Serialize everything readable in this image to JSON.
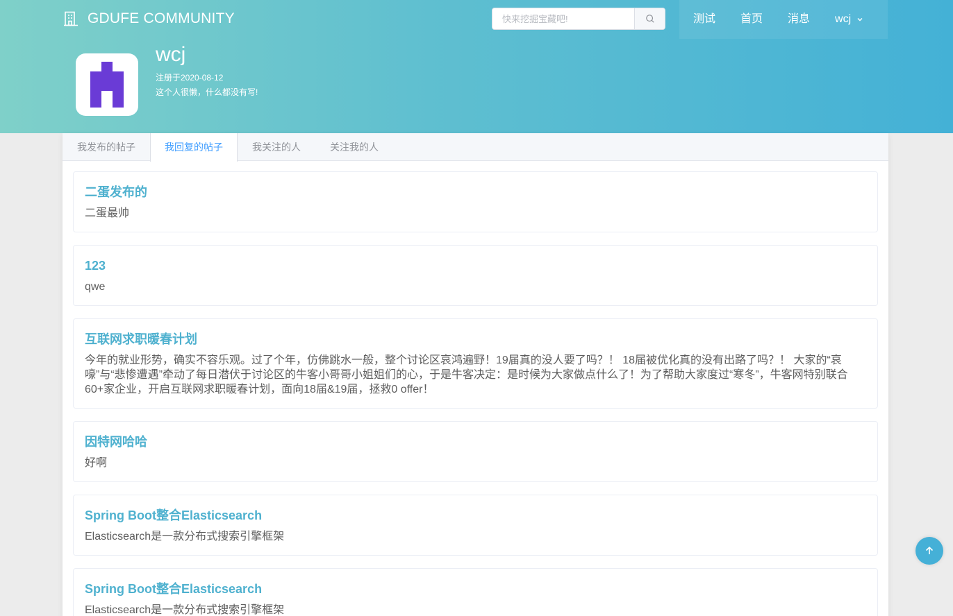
{
  "header": {
    "brand": "GDUFE COMMUNITY",
    "brand_icon": "building-icon",
    "search": {
      "placeholder": "快来挖掘宝藏吧!",
      "value": "",
      "icon": "search-icon"
    },
    "nav": [
      {
        "label": "测试"
      },
      {
        "label": "首页"
      },
      {
        "label": "消息"
      },
      {
        "label": "wcj",
        "icon": "chevron-down-icon"
      }
    ]
  },
  "profile": {
    "name": "wcj",
    "registered": "注册于2020-08-12",
    "bio": "这个人很懒，什么都没有写!",
    "avatar_color": "#6a3bd6"
  },
  "tabs": [
    {
      "label": "我发布的帖子",
      "active": false
    },
    {
      "label": "我回复的帖子",
      "active": true
    },
    {
      "label": "我关注的人",
      "active": false
    },
    {
      "label": "关注我的人",
      "active": false
    }
  ],
  "posts": [
    {
      "title": "二蛋发布的",
      "body": "二蛋最帅"
    },
    {
      "title": "123",
      "body": "qwe"
    },
    {
      "title": "互联网求职暖春计划",
      "body": "今年的就业形势，确实不容乐观。过了个年，仿佛跳水一般，整个讨论区哀鸿遍野！19届真的没人要了吗？！ 18届被优化真的没有出路了吗？！ 大家的“哀嚎”与“悲惨遭遇”牵动了每日潜伏于讨论区的牛客小哥哥小姐姐们的心，于是牛客决定：是时候为大家做点什么了！为了帮助大家度过“寒冬”，牛客网特别联合60+家企业，开启互联网求职暖春计划，面向18届&19届，拯救0 offer！"
    },
    {
      "title": "因特网哈哈",
      "body": "好啊"
    },
    {
      "title": "Spring Boot整合Elasticsearch",
      "body": "Elasticsearch是一款分布式搜索引擎框架"
    },
    {
      "title": "Spring Boot整合Elasticsearch",
      "body": "Elasticsearch是一款分布式搜索引擎框架"
    }
  ],
  "backtop": {
    "icon": "arrow-up-icon"
  },
  "colors": {
    "accent": "#409eff",
    "title": "#4fb1cf",
    "gradient_start": "#7fd0c9",
    "gradient_end": "#44b1d6"
  }
}
